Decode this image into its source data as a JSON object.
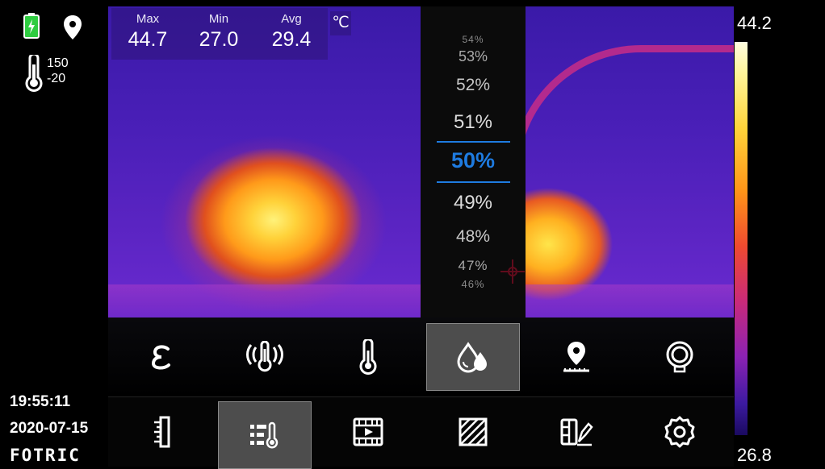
{
  "status": {
    "battery_icon": "battery-charging-icon",
    "location_icon": "location-pin-icon",
    "thermometer_icon": "thermometer-icon",
    "range_high": "150",
    "range_low": "-20"
  },
  "stats": {
    "max_label": "Max",
    "max_value": "44.7",
    "min_label": "Min",
    "min_value": "27.0",
    "avg_label": "Avg",
    "avg_value": "29.4",
    "unit": "℃"
  },
  "humidity_picker": {
    "options": [
      "54%",
      "53%",
      "52%",
      "51%",
      "50%",
      "49%",
      "48%",
      "47%",
      "46%"
    ],
    "selected": "50%",
    "accent": "#1e7be0"
  },
  "color_scale": {
    "max": "44.2",
    "min": "26.8"
  },
  "footer": {
    "time": "19:55:11",
    "date": "2020-07-15",
    "brand": "FOTRIC"
  },
  "toolbar_top": [
    {
      "icon": "emissivity-icon",
      "active": false
    },
    {
      "icon": "wireless-thermometer-icon",
      "active": false
    },
    {
      "icon": "temperature-icon",
      "active": false
    },
    {
      "icon": "humidity-icon",
      "active": true
    },
    {
      "icon": "distance-location-icon",
      "active": false
    },
    {
      "icon": "lens-icon",
      "active": false
    }
  ],
  "toolbar_bottom": [
    {
      "icon": "ruler-icon",
      "active": false
    },
    {
      "icon": "measure-settings-icon",
      "active": true
    },
    {
      "icon": "video-icon",
      "active": false
    },
    {
      "icon": "area-hatch-icon",
      "active": false
    },
    {
      "icon": "edit-palette-icon",
      "active": false
    },
    {
      "icon": "settings-gear-icon",
      "active": false
    }
  ]
}
